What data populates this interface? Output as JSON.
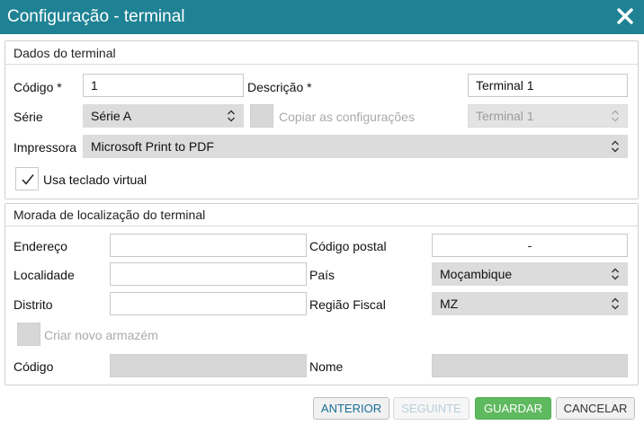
{
  "dialog": {
    "title": "Configuração - terminal"
  },
  "terminal": {
    "section_title": "Dados do terminal",
    "codigo_label": "Código *",
    "codigo_value": "1",
    "descricao_label": "Descrição *",
    "descricao_value": "Terminal 1",
    "serie_label": "Série",
    "serie_value": "Série A",
    "copiar_label": "Copiar as configurações",
    "copiar_checked": false,
    "copiar_source_value": "Terminal 1",
    "impressora_label": "Impressora",
    "impressora_value": "Microsoft Print to PDF",
    "teclado_label": "Usa teclado virtual",
    "teclado_checked": true
  },
  "address": {
    "section_title": "Morada de localização do terminal",
    "endereco_label": "Endereço",
    "endereco_value": "",
    "codigo_postal_label": "Código postal",
    "codigo_postal_value": "-",
    "localidade_label": "Localidade",
    "localidade_value": "",
    "pais_label": "País",
    "pais_value": "Moçambique",
    "distrito_label": "Distrito",
    "distrito_value": "",
    "regiao_label": "Região Fiscal",
    "regiao_value": "MZ",
    "armazem_label": "Criar novo armazém",
    "armazem_checked": false,
    "armazem_codigo_label": "Código",
    "armazem_codigo_value": "",
    "armazem_nome_label": "Nome",
    "armazem_nome_value": ""
  },
  "buttons": {
    "anterior": "ANTERIOR",
    "seguinte": "SEGUINTE",
    "guardar": "GUARDAR",
    "cancelar": "CANCELAR"
  },
  "colors": {
    "titlebar": "#1e8294",
    "primary_text": "#1a6f98",
    "success": "#5fb95f"
  }
}
